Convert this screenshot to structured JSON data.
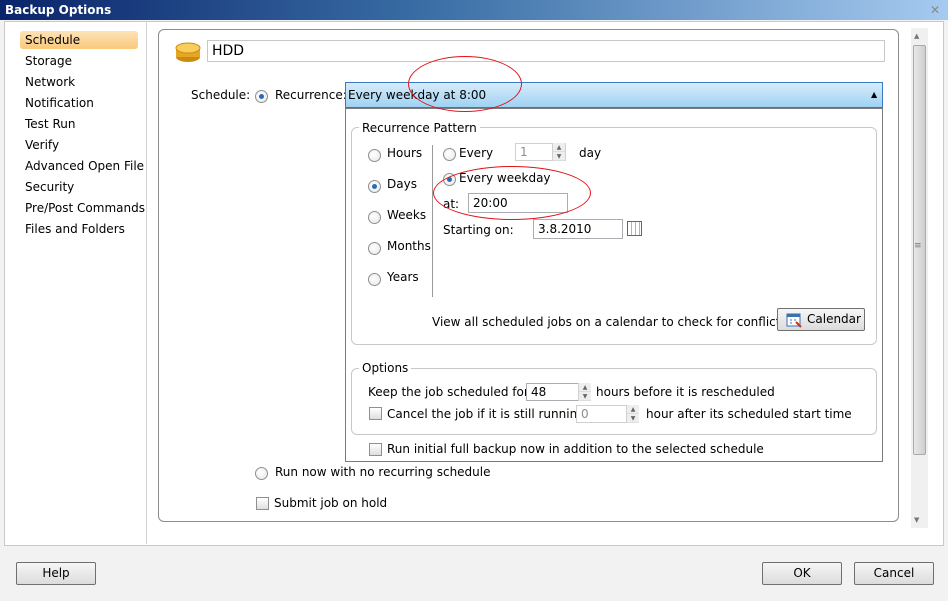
{
  "window": {
    "title": "Backup Options"
  },
  "nav": {
    "items": [
      {
        "label": "Schedule",
        "selected": true
      },
      {
        "label": "Storage"
      },
      {
        "label": "Network"
      },
      {
        "label": "Notification"
      },
      {
        "label": "Test Run"
      },
      {
        "label": "Verify"
      },
      {
        "label": "Advanced Open File"
      },
      {
        "label": "Security"
      },
      {
        "label": "Pre/Post Commands"
      },
      {
        "label": "Files and Folders"
      }
    ]
  },
  "header": {
    "name": "HDD"
  },
  "schedule": {
    "label": "Schedule:",
    "recurrence_label": "Recurrence:",
    "recurrence_value": "Every weekday at 8:00",
    "run_now_label": "Run now with no recurring schedule",
    "submit_hold_label": "Submit job on hold"
  },
  "pattern": {
    "title": "Recurrence Pattern",
    "types": [
      "Hours",
      "Days",
      "Weeks",
      "Months",
      "Years"
    ],
    "selected_type": "Days",
    "every_label": "Every",
    "every_value": "1",
    "every_unit": "day",
    "weekday_label": "Every weekday",
    "at_label": "at:",
    "at_value": "20:00",
    "starting_label": "Starting on:",
    "starting_value": "3.8.2010",
    "calendar_hint": "View all scheduled jobs on a calendar to check for conflicts.",
    "calendar_button": "Calendar"
  },
  "options": {
    "title": "Options",
    "keep_label": "Keep the job scheduled for",
    "keep_value": "48",
    "keep_suffix": "hours before it is rescheduled",
    "cancel_label": "Cancel the job if it is still running",
    "cancel_value": "0",
    "cancel_suffix": "hour after its scheduled start time",
    "initial_full_label": "Run initial full backup now in addition to the selected schedule"
  },
  "footer": {
    "help": "Help",
    "ok": "OK",
    "cancel": "Cancel"
  },
  "colors": {
    "accent": "#2a6bb5",
    "annotation": "#e0141c",
    "selected_nav": "#f9c97a"
  }
}
